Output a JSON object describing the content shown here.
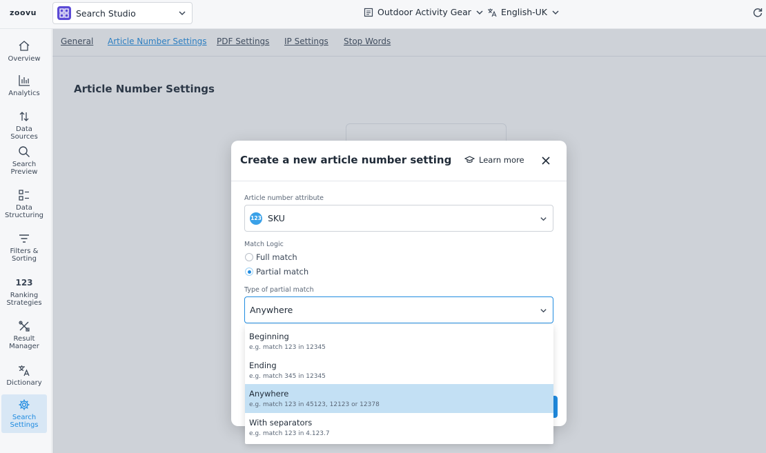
{
  "topbar": {
    "logo": "zoovu",
    "app_name": "Search Studio",
    "project": "Outdoor Activity Gear",
    "language": "English-UK"
  },
  "sidebar": {
    "items": [
      {
        "label": "Overview",
        "icon": "home-icon"
      },
      {
        "label": "Analytics",
        "icon": "bar-chart-icon"
      },
      {
        "label": "Data Sources",
        "icon": "arrows-updown-icon"
      },
      {
        "label": "Search Preview",
        "icon": "search-icon"
      },
      {
        "label": "Data Structuring",
        "icon": "structure-icon"
      },
      {
        "label": "Filters & Sorting",
        "icon": "filter-icon"
      },
      {
        "label": "Ranking Strategies",
        "icon": "ranking-icon",
        "glyph": "123"
      },
      {
        "label": "Result Manager",
        "icon": "tools-icon"
      },
      {
        "label": "Dictionary",
        "icon": "translate-icon"
      },
      {
        "label": "Search Settings",
        "icon": "gear-icon"
      }
    ]
  },
  "tabs": [
    "General",
    "Article Number Settings",
    "PDF Settings",
    "IP Settings",
    "Stop Words"
  ],
  "page": {
    "title": "Article Number Settings"
  },
  "modal": {
    "title": "Create a new article number setting",
    "learn_more": "Learn more",
    "attribute_label": "Article number attribute",
    "attribute_badge": "123",
    "attribute_value": "SKU",
    "match_logic_label": "Match Logic",
    "match_options": [
      "Full match",
      "Partial match"
    ],
    "match_selected": "Partial match",
    "partial_type_label": "Type of partial match",
    "partial_type_value": "Anywhere"
  },
  "dropdown": {
    "options": [
      {
        "title": "Beginning",
        "example": "e.g. match 123 in 12345"
      },
      {
        "title": "Ending",
        "example": "e.g. match 345 in 12345"
      },
      {
        "title": "Anywhere",
        "example": "e.g. match 123 in 45123, 12123 or 12378"
      },
      {
        "title": "With separators",
        "example": "e.g. match 123 in 4.123.7"
      }
    ],
    "selected": "Anywhere"
  },
  "colors": {
    "accent": "#1f8be0",
    "selected_option_bg": "#c3e0f4",
    "app_icon": "#5b4ad6"
  }
}
